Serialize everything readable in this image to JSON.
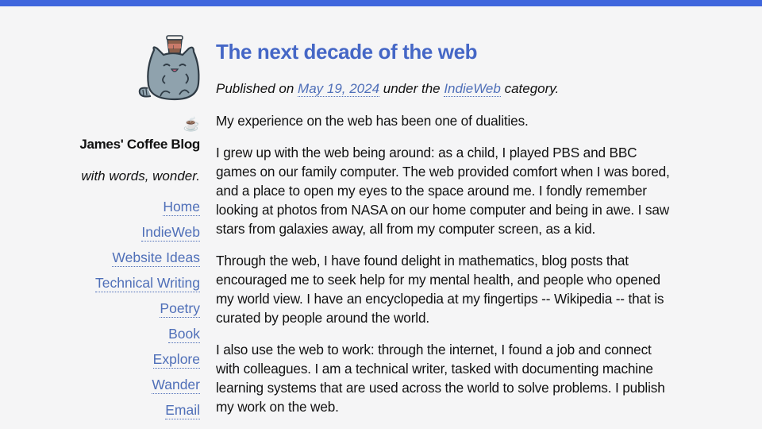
{
  "theme": {
    "accent": "#3f66dd",
    "link": "#4f6fb8",
    "title": "#4567c6",
    "background": "#f5f5f6"
  },
  "sidebar": {
    "logo_icon": "coffee-cat-icon",
    "coffee_emoji": "☕",
    "site_title": "James' Coffee Blog",
    "tagline": "with words, wonder.",
    "nav": [
      {
        "label": "Home"
      },
      {
        "label": "IndieWeb"
      },
      {
        "label": "Website Ideas"
      },
      {
        "label": "Technical Writing"
      },
      {
        "label": "Poetry"
      },
      {
        "label": "Book"
      },
      {
        "label": "Explore"
      },
      {
        "label": "Wander"
      },
      {
        "label": "Email"
      }
    ]
  },
  "post": {
    "title": "The next decade of the web",
    "meta": {
      "prefix": "Published on ",
      "date": "May 19, 2024",
      "middle": " under the ",
      "category": "IndieWeb",
      "suffix": " category."
    },
    "paragraphs": [
      "My experience on the web has been one of dualities.",
      "I grew up with the web being around: as a child, I played PBS and BBC games on our family computer. The web provided comfort when I was bored, and a place to open my eyes to the space around me. I fondly remember looking at photos from NASA on our home computer and being in awe. I saw stars from galaxies away, all from my computer screen, as a kid.",
      "Through the web, I have found delight in mathematics, blog posts that encouraged me to seek help for my mental health, and people who opened my world view. I have an encyclopedia at my fingertips -- Wikipedia -- that is curated by people around the world.",
      "I also use the web to work: through the internet, I found a job and connect with colleagues. I am a technical writer, tasked with documenting machine learning systems that are used across the world to solve problems. I publish my work on the web."
    ]
  }
}
